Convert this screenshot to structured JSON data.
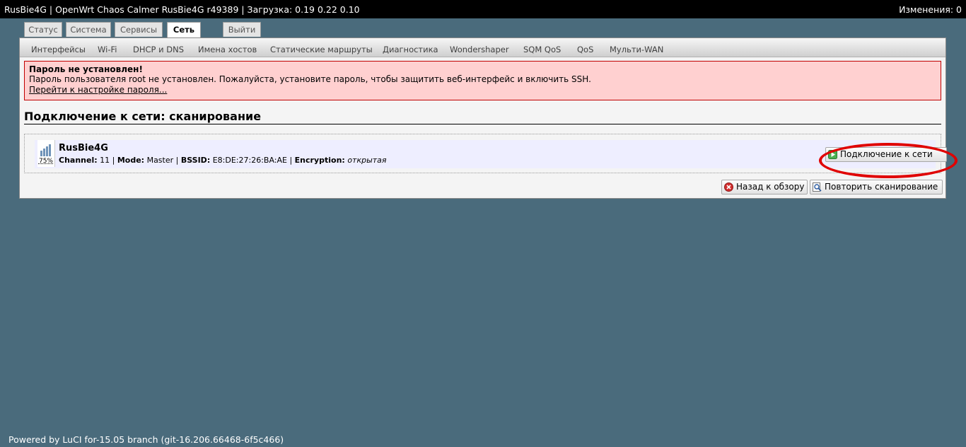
{
  "topbar": {
    "hostinfo": "RusBie4G | OpenWrt Chaos Calmer RusBie4G r49389 | Загрузка: 0.19 0.22 0.10",
    "changes": "Изменения: 0"
  },
  "tabs": [
    {
      "label": "Статус"
    },
    {
      "label": "Система"
    },
    {
      "label": "Сервисы"
    },
    {
      "label": "Сеть",
      "active": true
    },
    {
      "label": "Выйти"
    }
  ],
  "subnav": [
    {
      "label": "Интерфейсы"
    },
    {
      "label": "Wi-Fi"
    },
    {
      "label": "DHCP и DNS"
    },
    {
      "label": "Имена хостов"
    },
    {
      "label": "Статические маршруты"
    },
    {
      "label": "Диагностика"
    },
    {
      "label": "Wondershaper"
    },
    {
      "label": "SQM QoS"
    },
    {
      "label": "QoS"
    },
    {
      "label": "Мульти-WAN"
    }
  ],
  "alert": {
    "title": "Пароль не установлен!",
    "message": "Пароль пользователя root не установлен. Пожалуйста, установите пароль, чтобы защитить веб-интерфейс и включить SSH.",
    "link": "Перейти к настройке пароля..."
  },
  "page_title": "Подключение к сети: сканирование",
  "network": {
    "ssid": "RusBie4G",
    "signal_percent": "75%",
    "channel_label": "Channel:",
    "channel": "11",
    "mode_label": "Mode:",
    "mode": "Master",
    "bssid_label": "BSSID:",
    "bssid": "E8:DE:27:26:BA:AE",
    "encryption_label": "Encryption:",
    "encryption": "открытая",
    "separator": " | ",
    "connect_label": "Подключение к сети"
  },
  "buttons": {
    "back": "Назад к обзору",
    "rescan": "Повторить сканирование"
  },
  "footer": "Powered by LuCI for-15.05 branch (git-16.206.66468-6f5c466)",
  "colors": {
    "background": "#4a6b7c",
    "alert_bg": "#ffd0d0",
    "alert_border": "#c00000",
    "highlight": "#e00000",
    "row_bg": "#eeeeff"
  }
}
